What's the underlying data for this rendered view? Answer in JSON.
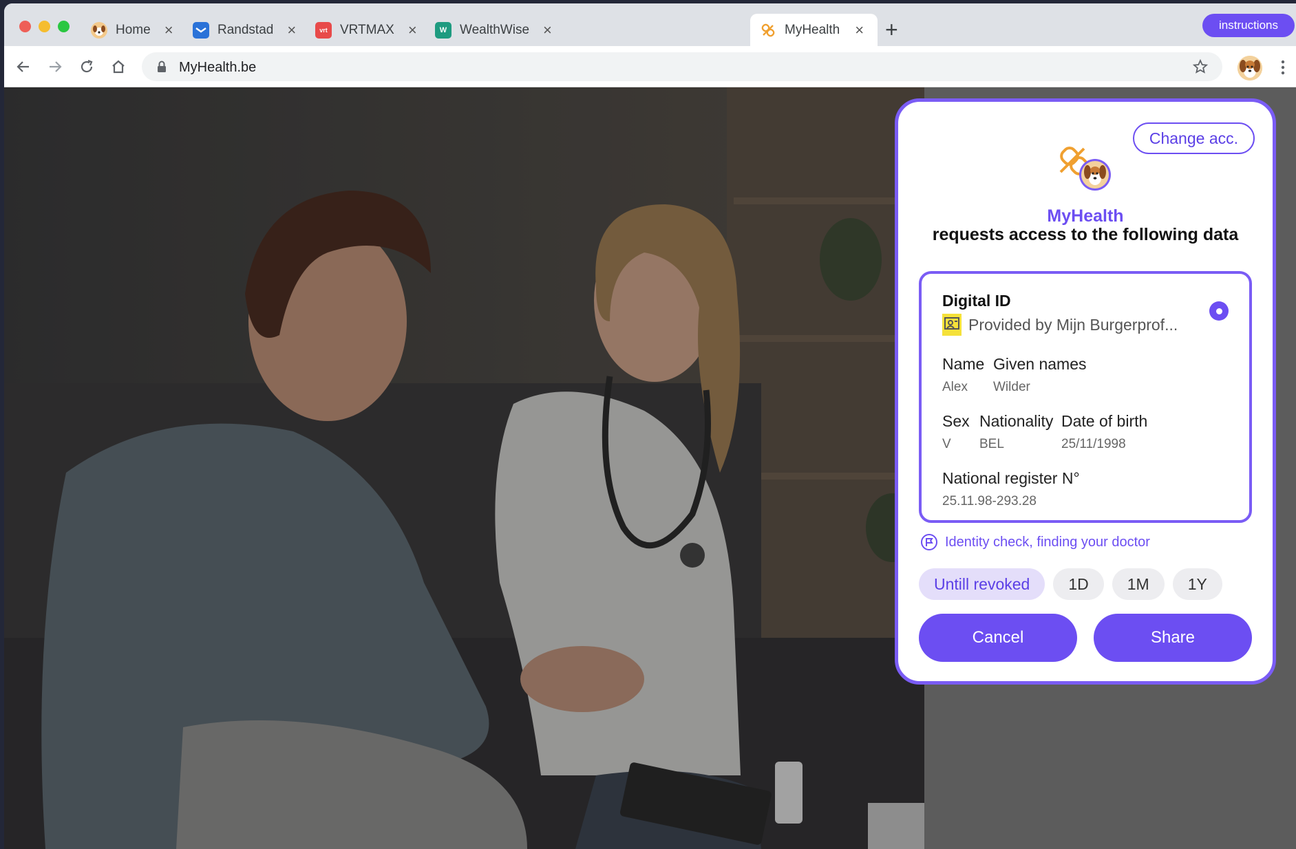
{
  "browser": {
    "tabs": [
      {
        "label": "Home",
        "icon": "dog-avatar-icon"
      },
      {
        "label": "Randstad",
        "icon": "randstad-logo-icon"
      },
      {
        "label": "VRTMAX",
        "icon": "vrtmax-logo-icon"
      },
      {
        "label": "WealthWise",
        "icon": "wealthwise-logo-icon"
      },
      {
        "label": "MyHealth",
        "icon": "myhealth-logo-icon",
        "active": true
      }
    ],
    "instructions_label": "instructions",
    "url": "MyHealth.be"
  },
  "dialog": {
    "change_account_label": "Change acc.",
    "app_name": "MyHealth",
    "request_text": "requests access to the following data",
    "card": {
      "title": "Digital ID",
      "provider": "Provided by Mijn Burgerprof...",
      "name_label": "Name",
      "name_value": "Alex",
      "given_names_label": "Given names",
      "given_names_value": "Wilder",
      "sex_label": "Sex",
      "sex_value": "V",
      "nationality_label": "Nationality",
      "nationality_value": "BEL",
      "dob_label": "Date of birth",
      "dob_value": "25/11/1998",
      "register_label": "National register N°",
      "register_value": "25.11.98-293.28"
    },
    "purpose": "Identity check, finding your doctor",
    "durations": [
      {
        "label": "Untill revoked",
        "selected": true
      },
      {
        "label": "1D",
        "selected": false
      },
      {
        "label": "1M",
        "selected": false
      },
      {
        "label": "1Y",
        "selected": false
      }
    ],
    "cancel_label": "Cancel",
    "share_label": "Share"
  },
  "colors": {
    "accent": "#6c4ef2",
    "accent_border": "#7a5cf5",
    "pill_selected_bg": "#e4defa",
    "browser_chrome": "#dee1e6"
  }
}
